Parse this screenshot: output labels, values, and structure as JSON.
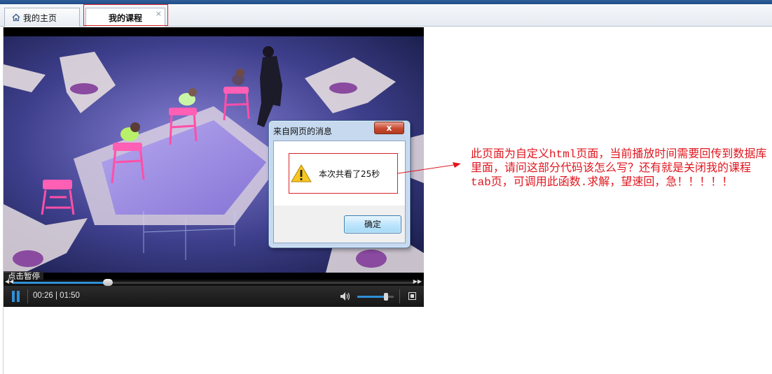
{
  "tabs": {
    "home_label": "我的主页",
    "course_label": "我的课程",
    "close_glyph": "×"
  },
  "player": {
    "pause_hint": "点击暂停",
    "current_time": "00:26",
    "duration": "01:50",
    "progress_fraction": 0.2364,
    "volume_fraction": 0.78,
    "accent_color": "#2f8fd8"
  },
  "dialog": {
    "title": "来自网页的消息",
    "close_glyph": "x",
    "message": "本次共看了25秒",
    "ok_label": "确定",
    "icon": "warning-icon"
  },
  "annotation": {
    "text": "此页面为自定义html页面，当前播放时间需要回传到数据库里面，请问这部分代码该怎么写？还有就是关闭我的课程tab页，可调用此函数.求解，望速回，急！！！！！",
    "color": "#e0161e"
  }
}
